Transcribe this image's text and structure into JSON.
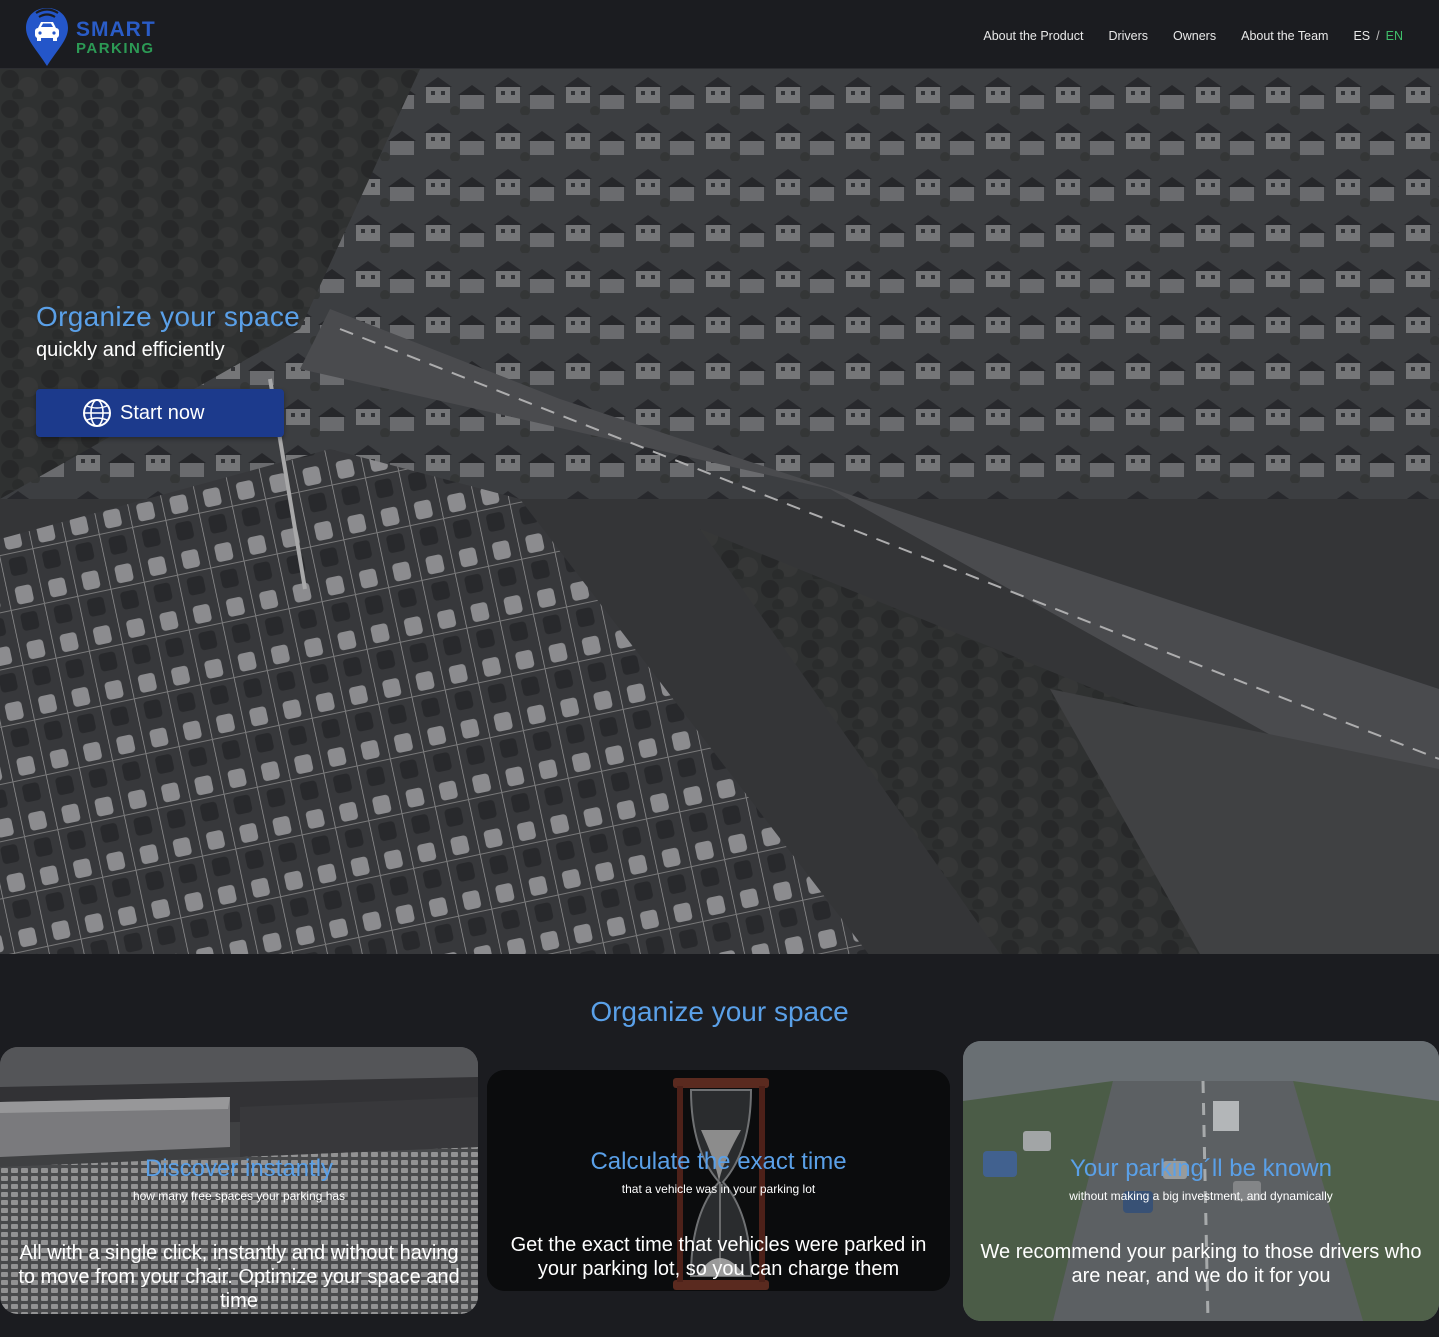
{
  "brand": {
    "line1": "SMART",
    "line2": "PARKING"
  },
  "nav": {
    "items": [
      "About the Product",
      "Drivers",
      "Owners",
      "About the Team"
    ],
    "lang": {
      "es": "ES",
      "separator": "/",
      "en": "EN",
      "active": "EN"
    }
  },
  "hero": {
    "title": "Organize your space",
    "subtitle": "quickly and efficiently",
    "cta_label": "Start now",
    "cta_icon": "globe-icon"
  },
  "section": {
    "title": "Organize your space",
    "cards": [
      {
        "title": "Discover instantly",
        "subtitle": "how many free spaces your parking has",
        "body": "All with a single click, instantly and without having to move from your chair. Optimize your space and time"
      },
      {
        "title": "Calculate the exact time",
        "subtitle": "that a vehicle was in your parking lot",
        "body": "Get the exact time that vehicles were parked in your parking lot, so you can charge them"
      },
      {
        "title": "Your parking´ll be known",
        "subtitle": "without making a big investment, and dynamically",
        "body": "We recommend your parking to those drivers who are near, and we do it for you"
      }
    ]
  },
  "colors": {
    "accent": "#5aa0e8",
    "cta_bg": "#1c3a8c",
    "brand_blue": "#2a5cc7",
    "brand_green": "#2c9a55",
    "lang_active": "#3fbf6a",
    "page_bg": "#1b1c20"
  }
}
